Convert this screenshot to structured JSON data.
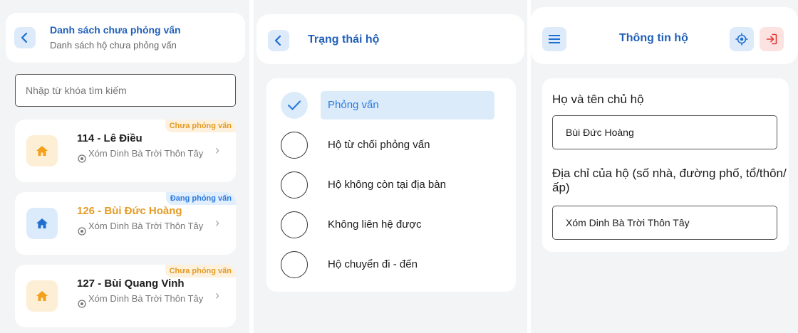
{
  "panel1": {
    "header": {
      "title": "Danh sách chưa phỏng vấn",
      "subtitle": "Danh sách hộ chưa phỏng vấn",
      "back_icon": "chevron-left-icon"
    },
    "search": {
      "placeholder": "Nhập từ khóa tìm kiếm",
      "value": ""
    },
    "households": [
      {
        "name": "114 - Lê Điều",
        "address": "Xóm Dinh Bà Trời Thôn Tây",
        "status": "Chưa phỏng vấn",
        "status_color": "#e49b24"
      },
      {
        "name": "126 - Bùi Đức Hoàng",
        "address": "Xóm Dinh Bà Trời Thôn Tây",
        "status": "Đang phỏng vấn",
        "status_color": "#2b7be0"
      },
      {
        "name": "127 - Bùi Quang Vinh",
        "address": "Xóm Dinh Bà Trời Thôn Tây",
        "status": "Chưa phỏng vấn",
        "status_color": "#e49b24"
      }
    ]
  },
  "panel2": {
    "header": {
      "title": "Trạng thái hộ",
      "back_icon": "chevron-left-icon"
    },
    "options": [
      {
        "label": "Phỏng vấn",
        "selected": true
      },
      {
        "label": "Hộ từ chối phỏng vấn",
        "selected": false
      },
      {
        "label": "Hộ không còn tại địa bàn",
        "selected": false
      },
      {
        "label": "Không liên hệ được",
        "selected": false
      },
      {
        "label": "Hộ chuyển đi - đến",
        "selected": false
      }
    ]
  },
  "panel3": {
    "header": {
      "title": "Thông tin hộ",
      "menu_icon": "menu-icon",
      "gps_icon": "gps-icon",
      "logout_icon": "logout-icon"
    },
    "fields": [
      {
        "label": "Họ và tên chủ hộ",
        "value": "Bùi Đức Hoàng"
      },
      {
        "label": "Địa chỉ của hộ (số nhà, đường phố, tổ/thôn/ấp)",
        "value": "Xóm Dinh Bà Trời Thôn Tây"
      }
    ]
  },
  "colors": {
    "primary": "#1f5fb8",
    "accent_blue": "#2b7be0",
    "accent_orange": "#e49b24",
    "logout_red": "#e53935"
  }
}
